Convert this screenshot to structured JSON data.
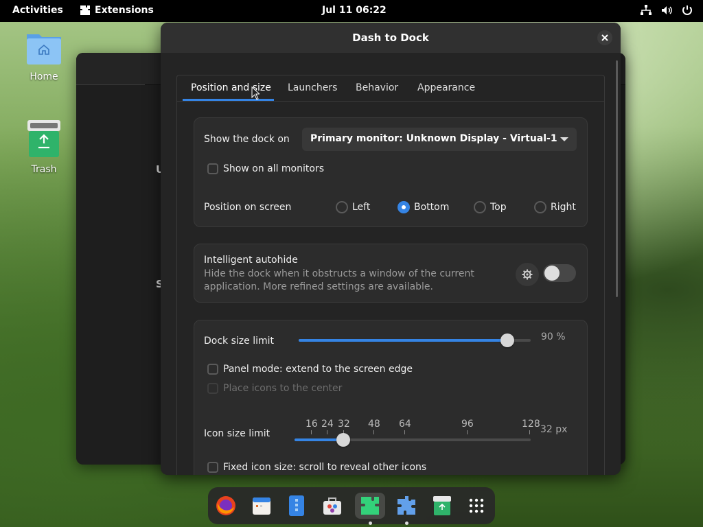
{
  "topbar": {
    "activities": "Activities",
    "app_name": "Extensions",
    "clock": "Jul 11  06:22"
  },
  "desktop": {
    "home_label": "Home",
    "trash_label": "Trash"
  },
  "background_window": {
    "clipped_heading_1": "U",
    "clipped_heading_2": "S"
  },
  "dialog": {
    "title": "Dash to Dock",
    "tabs": [
      {
        "label": "Position and size"
      },
      {
        "label": "Launchers"
      },
      {
        "label": "Behavior"
      },
      {
        "label": "Appearance"
      }
    ],
    "position": {
      "show_dock_on_label": "Show the dock on",
      "monitor_value": "Primary monitor: Unknown Display - Virtual-1",
      "all_monitors_label": "Show on all monitors",
      "position_label": "Position on screen",
      "options": [
        "Left",
        "Bottom",
        "Top",
        "Right"
      ],
      "selected": "Bottom"
    },
    "autohide": {
      "title": "Intelligent autohide",
      "desc_line1": "Hide the dock when it obstructs a window of the current",
      "desc_line2": "application. More refined settings are available.",
      "enabled": false
    },
    "size": {
      "dock_limit_label": "Dock size limit",
      "dock_limit_value": "90 %",
      "dock_limit_percent": 90,
      "panel_mode_label": "Panel mode: extend to the screen edge",
      "center_icons_label": "Place icons to the center",
      "icon_limit_label": "Icon size limit",
      "icon_marks": [
        "16",
        "24",
        "32",
        "48",
        "64",
        "96",
        "128"
      ],
      "icon_value": "32 px",
      "icon_value_num": 32,
      "fixed_icon_label": "Fixed icon size: scroll to reveal other icons"
    }
  },
  "dock": {
    "items": [
      "firefox-icon",
      "calendar-icon",
      "files-icon",
      "software-icon",
      "extensions-icon",
      "puzzle-icon",
      "trash-icon",
      "app-grid-icon"
    ],
    "active_index": 4
  },
  "colors": {
    "accent": "#3584e4",
    "window_bg": "#242424",
    "card_bg": "#2c2c2c"
  }
}
